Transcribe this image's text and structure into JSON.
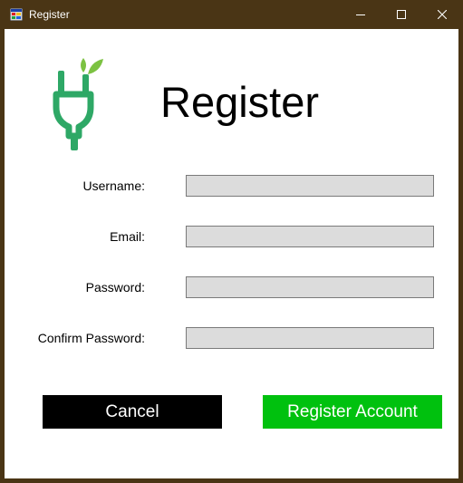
{
  "window": {
    "title": "Register",
    "icons": [
      "app-icon",
      "minimize-icon",
      "maximize-icon",
      "close-icon"
    ]
  },
  "header": {
    "title": "Register",
    "logo": "plug-leaf-logo"
  },
  "form": {
    "username_label": "Username:",
    "email_label": "Email:",
    "password_label": "Password:",
    "confirm_password_label": "Confirm Password:",
    "username_value": "",
    "email_value": "",
    "password_value": "",
    "confirm_password_value": ""
  },
  "buttons": {
    "cancel_label": "Cancel",
    "register_label": "Register Account"
  },
  "colors": {
    "titlebar": "#4a3515",
    "input_bg": "#dcdcdc",
    "cancel_bg": "#000000",
    "register_bg": "#00c10e",
    "logo_green": "#2ea866",
    "leaf_green": "#7cc242"
  }
}
